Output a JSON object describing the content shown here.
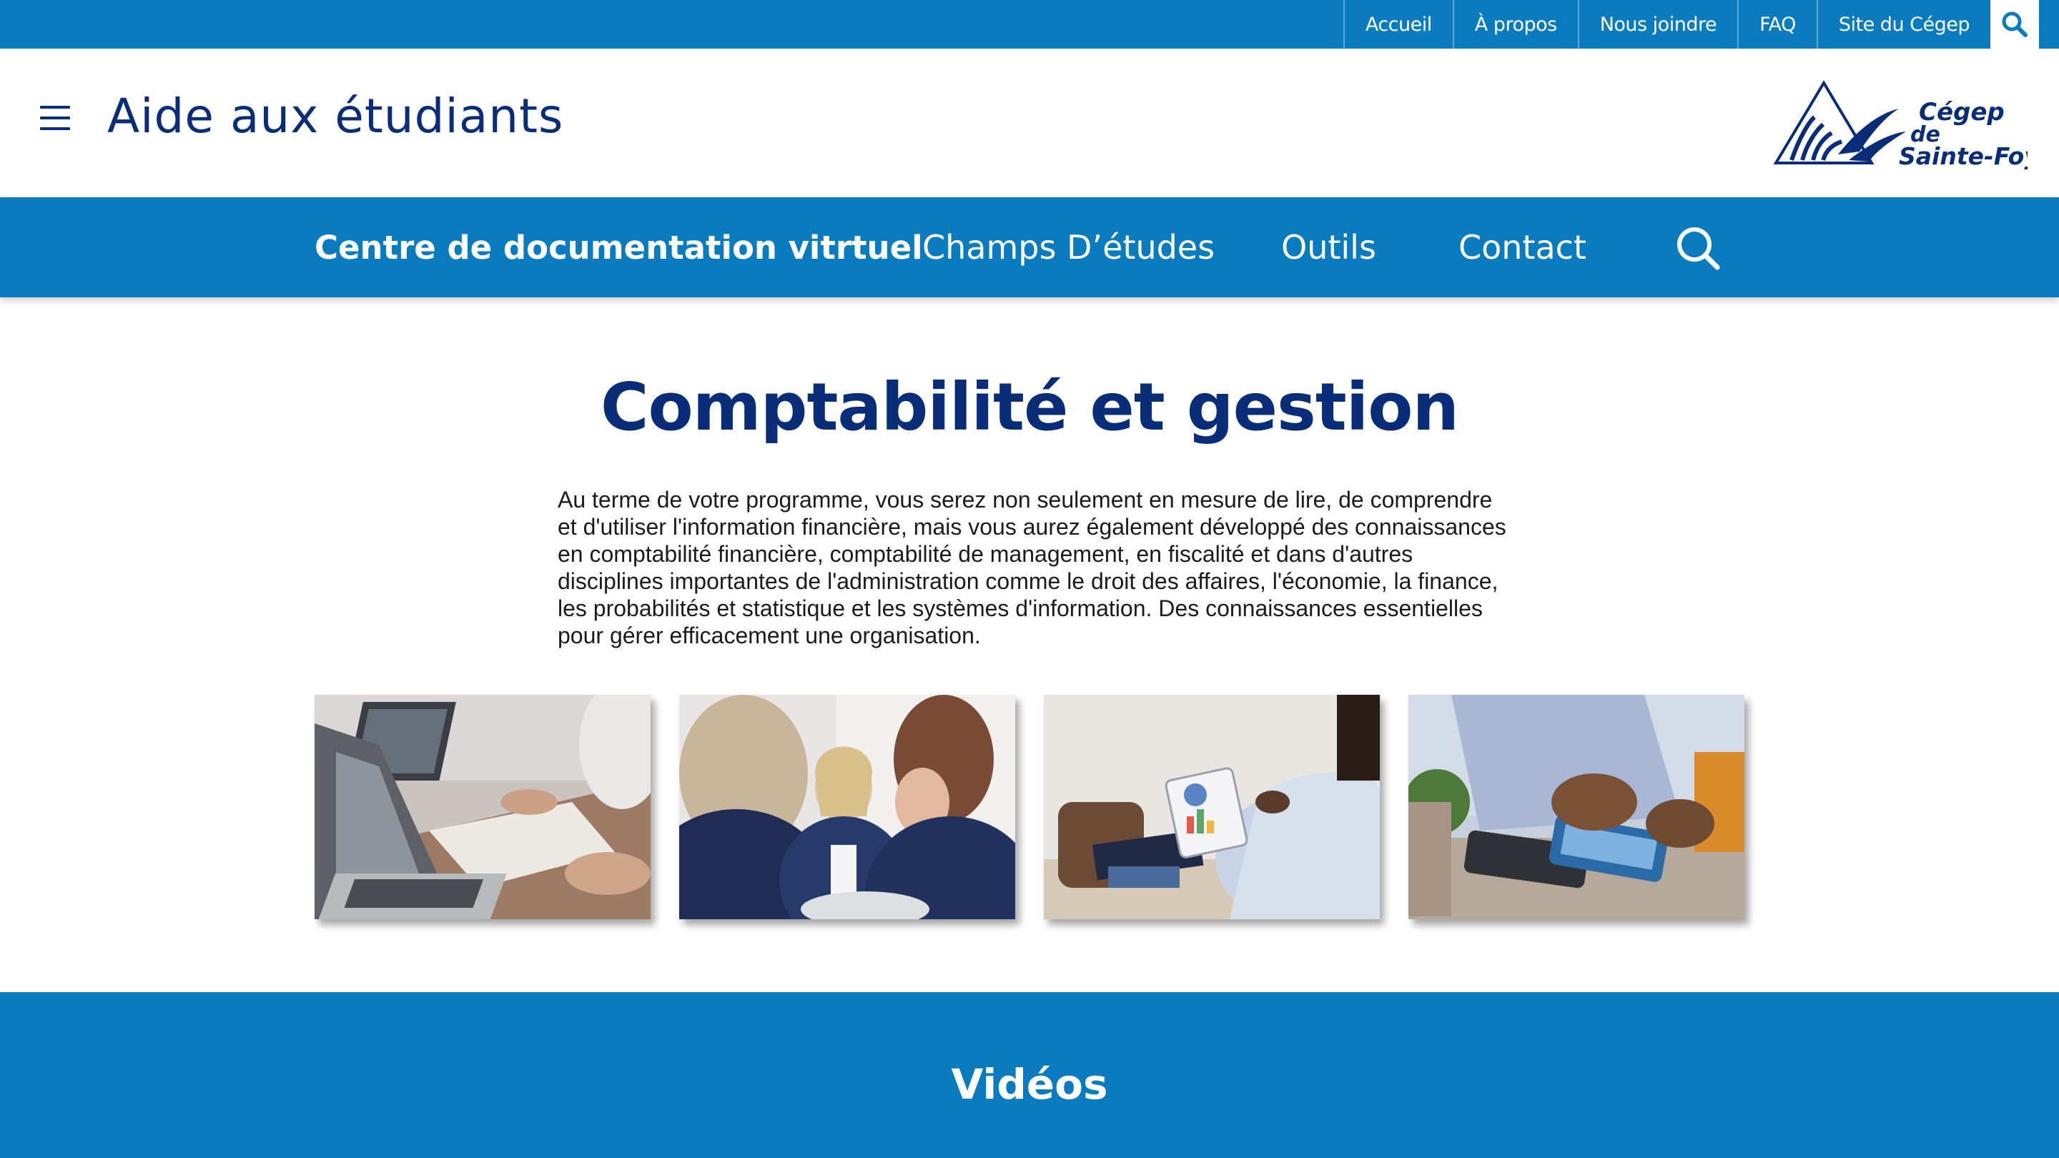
{
  "topbar": {
    "links": [
      "Accueil",
      "À propos",
      "Nous joindre",
      "FAQ",
      "Site du Cégep"
    ],
    "search_icon": "search-icon"
  },
  "header": {
    "menu_icon": "hamburger-menu-icon",
    "title": "Aide aux étudiants",
    "logo": {
      "line1": "Cégep",
      "line2": "de",
      "line3": "Sainte-Foy"
    }
  },
  "nav": {
    "items": [
      "Centre de documentation vitrtuel",
      "Champs D’études",
      "Outils",
      "Contact"
    ],
    "active_index": 0,
    "search_icon": "search-icon"
  },
  "main": {
    "title": "Comptabilité et gestion",
    "intro": "Au terme de votre programme, vous serez non seulement en mesure de lire, de comprendre et d'utiliser l'information financière, mais vous aurez également développé des connaissances en comptabilité financière, comptabilité de management, en fiscalité et dans d'autres disciplines importantes de l'administration comme le droit des affaires, l'économie, la finance, les probabilités et statistique et les systèmes d'information. Des connaissances essentielles pour gérer efficacement une organisation.",
    "gallery": [
      "laptops-paperwork-photo",
      "business-meeting-photo",
      "tablet-charts-photo",
      "calculator-photo"
    ]
  },
  "videos": {
    "title": "Vidéos"
  },
  "colors": {
    "primary_blue": "#0a7bbf",
    "dark_navy": "#0a2d7a",
    "text": "#1b1b1b",
    "white": "#ffffff"
  }
}
